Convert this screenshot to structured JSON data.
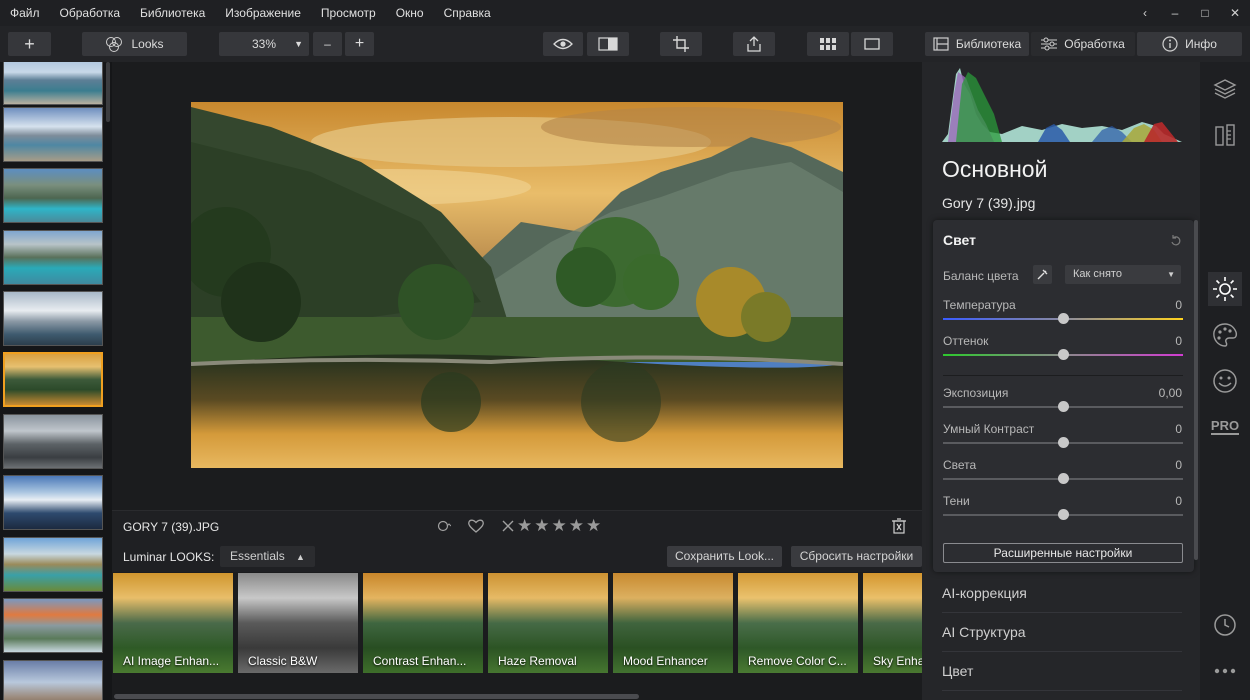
{
  "menu": [
    "Файл",
    "Обработка",
    "Библиотека",
    "Изображение",
    "Просмотр",
    "Окно",
    "Справка"
  ],
  "window_controls": [
    "‹",
    "–",
    "□",
    "✕"
  ],
  "toolbar": {
    "add_label": "+",
    "looks_label": "Looks",
    "zoom_value": "33%",
    "zoom_out_label": "–",
    "zoom_in_label": "+",
    "library_label": "Библиотека",
    "edit_label": "Обработка",
    "info_label": "Инфо"
  },
  "image": {
    "filename": "GORY 7 (39).JPG",
    "rating_stars": 0
  },
  "looks": {
    "title": "Luminar LOOKS:",
    "category": "Essentials",
    "save_label": "Сохранить Look...",
    "reset_label": "Сбросить настройки",
    "items": [
      {
        "name": "AI Image Enhan..."
      },
      {
        "name": "Classic B&W"
      },
      {
        "name": "Contrast Enhan..."
      },
      {
        "name": "Haze Removal"
      },
      {
        "name": "Mood Enhancer"
      },
      {
        "name": "Remove Color C..."
      },
      {
        "name": "Sky Enha"
      }
    ]
  },
  "panel": {
    "title": "Основной",
    "file": "Gory 7 (39).jpg",
    "light": {
      "title": "Свет",
      "wb_label": "Баланс цвета",
      "wb_value": "Как снято",
      "sliders": [
        {
          "label": "Температура",
          "value": "0",
          "level": 0.5
        },
        {
          "label": "Оттенок",
          "value": "0",
          "level": 0.5
        },
        {
          "label": "Экспозиция",
          "value": "0,00",
          "level": 0.5
        },
        {
          "label": "Умный Контраст",
          "value": "0",
          "level": 0.5
        },
        {
          "label": "Света",
          "value": "0",
          "level": 0.5
        },
        {
          "label": "Тени",
          "value": "0",
          "level": 0.5
        }
      ],
      "advanced_label": "Расширенные настройки"
    },
    "sections": [
      "AI-коррекция",
      "AI Структура",
      "Цвет"
    ],
    "pro_label": "PRO"
  },
  "colors": {
    "accent": "#f0a020",
    "temperature_gradient": [
      "#3a5cff",
      "#ffd21e"
    ],
    "tint_gradient": [
      "#2ec82e",
      "#d23cd2"
    ]
  }
}
